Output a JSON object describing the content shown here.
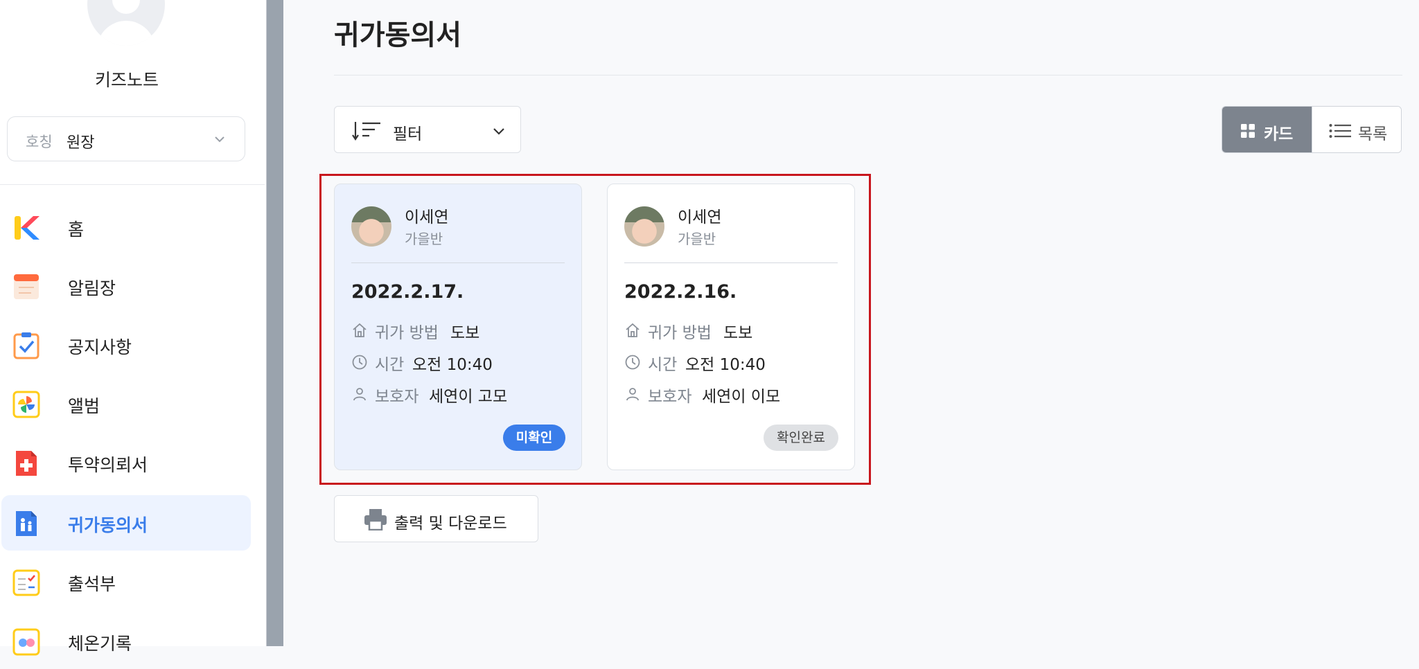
{
  "sidebar": {
    "school_name": "키즈노트",
    "title_select": {
      "label": "호칭",
      "value": "원장"
    },
    "items": [
      {
        "label": "홈",
        "icon": "kidsnote-logo-icon"
      },
      {
        "label": "알림장",
        "icon": "notebook-icon"
      },
      {
        "label": "공지사항",
        "icon": "checklist-icon"
      },
      {
        "label": "앨범",
        "icon": "pinwheel-icon"
      },
      {
        "label": "투약의뢰서",
        "icon": "medicine-icon"
      },
      {
        "label": "귀가동의서",
        "icon": "going-home-icon",
        "active": true
      },
      {
        "label": "출석부",
        "icon": "attendance-icon"
      },
      {
        "label": "체온기록",
        "icon": "temperature-icon"
      }
    ]
  },
  "main": {
    "title": "귀가동의서",
    "filter_label": "필터",
    "view_toggle": {
      "card": "카드",
      "list": "목록",
      "selected": "card"
    },
    "cards": [
      {
        "name": "이세연",
        "class": "가을반",
        "date": "2022.2.17.",
        "method_label": "귀가 방법",
        "method": "도보",
        "time_label": "시간",
        "time": "오전 10:40",
        "guardian_label": "보호자",
        "guardian": "세연이 고모",
        "status": "미확인"
      },
      {
        "name": "이세연",
        "class": "가을반",
        "date": "2022.2.16.",
        "method_label": "귀가 방법",
        "method": "도보",
        "time_label": "시간",
        "time": "오전 10:40",
        "guardian_label": "보호자",
        "guardian": "세연이 이모",
        "status": "확인완료"
      }
    ],
    "print_label": "출력 및 다운로드"
  },
  "colors": {
    "accent": "#3a7dea",
    "highlight_border": "#c8161d",
    "toggle_selected": "#7d848e"
  }
}
